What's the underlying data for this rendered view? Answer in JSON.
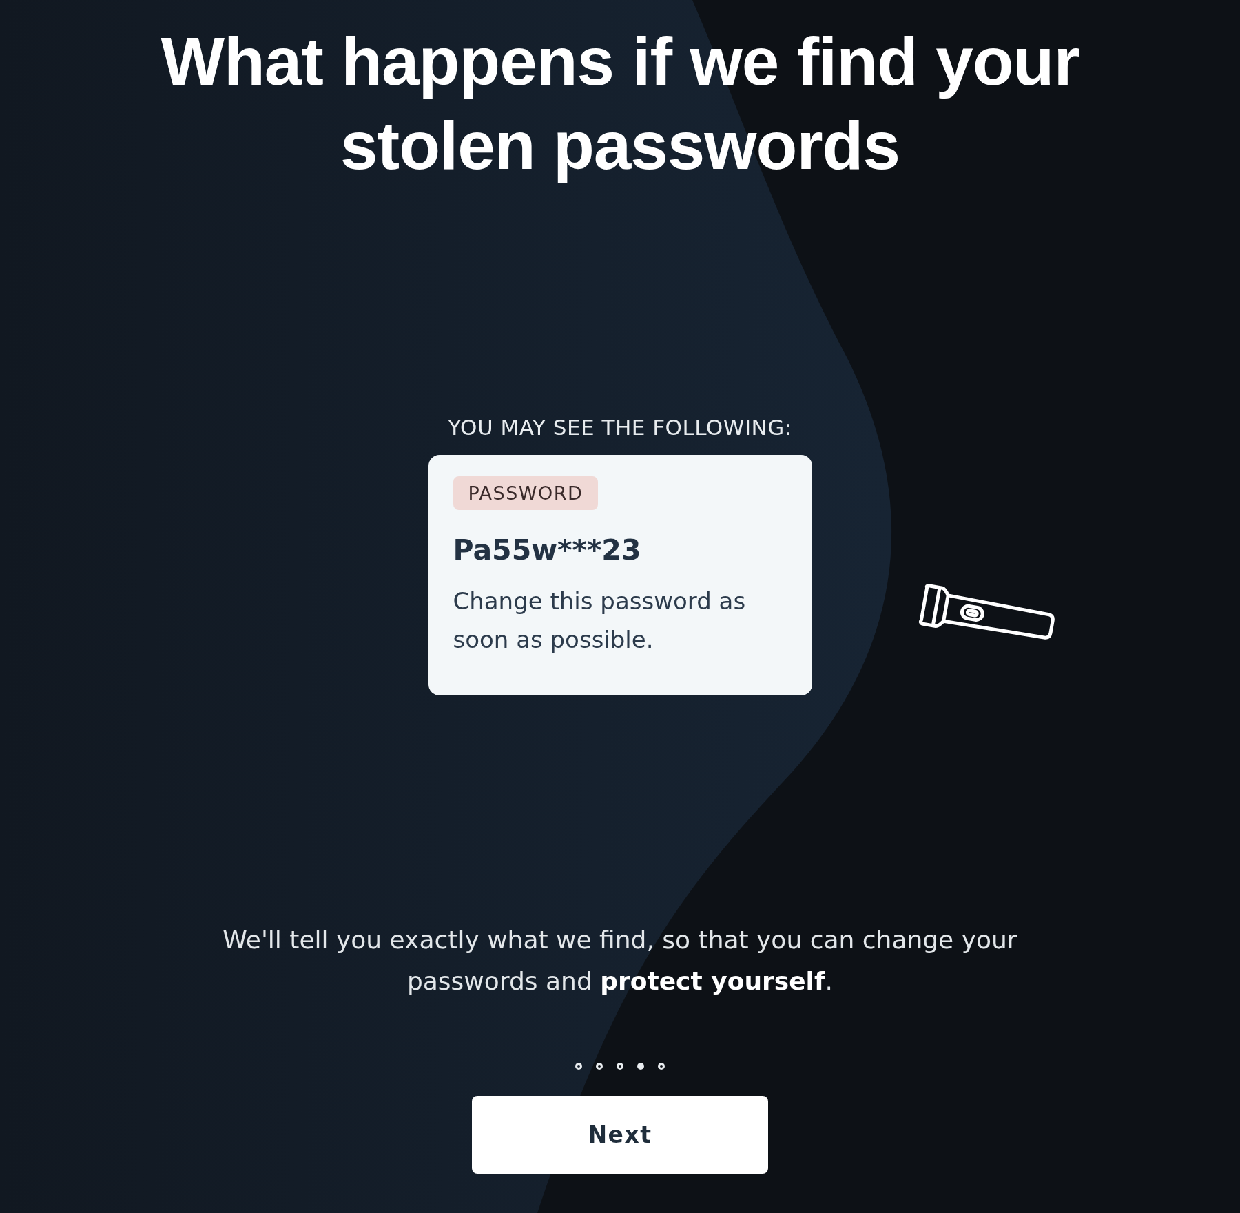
{
  "title": "What happens if we find your stolen passwords",
  "example": {
    "heading": "YOU MAY SEE THE FOLLOWING:",
    "card": {
      "tag": "PASSWORD",
      "password": "Pa55w***23",
      "advice": "Change this password as soon as possible."
    }
  },
  "description": "We'll tell you exactly what we find, so that you can change your passwords and **protect yourself**.",
  "pager": [
    {
      "selected": false
    },
    {
      "selected": false
    },
    {
      "selected": false
    },
    {
      "selected": true
    },
    {
      "selected": false
    }
  ],
  "button": "Next"
}
